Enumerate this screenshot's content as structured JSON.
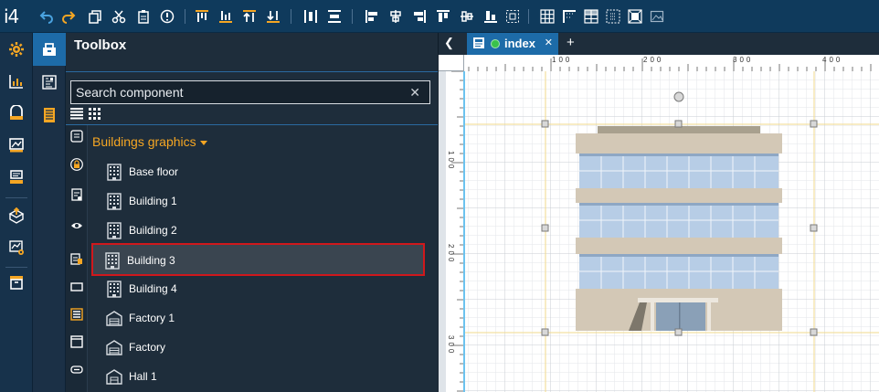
{
  "app": {
    "logo": "i4"
  },
  "toolbar": {
    "icons": [
      "undo-icon",
      "redo-icon",
      "copy-icon",
      "cut-icon",
      "paste-icon",
      "info-icon",
      "align-top-icon",
      "align-bottom-icon",
      "bring-forward-icon",
      "send-backward-icon",
      "distribute-horizontal-icon",
      "distribute-vertical-icon",
      "align-left-icon",
      "align-center-icon",
      "align-right-icon",
      "align-top-edge-icon",
      "align-middle-icon",
      "align-bottom-edge-icon",
      "group-icon",
      "grid-icon",
      "corner-icon",
      "table-icon",
      "select-icon",
      "component-icon",
      "image-icon"
    ]
  },
  "rail": {
    "icons": [
      "settings-icon",
      "dashboard-icon",
      "device-icon",
      "monitor-icon",
      "printer-icon",
      "export-icon",
      "chart-settings-icon",
      "archive-icon"
    ]
  },
  "panel_tabs": {
    "icons": [
      "toolbox-icon",
      "component-tree-icon",
      "page-icon"
    ]
  },
  "toolbox": {
    "title": "Toolbox",
    "search": {
      "placeholder": "Search component",
      "value": ""
    },
    "clear_symbol": "✕",
    "group": "Buildings graphics",
    "categories": [
      "list-icon",
      "lock-icon",
      "doc-icon",
      "eye-icon",
      "clipboard-icon",
      "rectangle-icon",
      "menu-icon",
      "frame-icon",
      "link-icon"
    ],
    "items": [
      {
        "label": "Base floor",
        "icon": "building-icon"
      },
      {
        "label": "Building 1",
        "icon": "building-icon"
      },
      {
        "label": "Building 2",
        "icon": "building-icon"
      },
      {
        "label": "Building 3",
        "icon": "building-icon",
        "selected": true
      },
      {
        "label": "Building 4",
        "icon": "building-icon"
      },
      {
        "label": "Factory 1",
        "icon": "factory-icon"
      },
      {
        "label": "Factory",
        "icon": "factory-icon"
      },
      {
        "label": "Hall 1",
        "icon": "hall-icon"
      }
    ]
  },
  "editor": {
    "nav_left": "❮",
    "tab": {
      "name": "index",
      "close": "✕"
    },
    "add": "+",
    "ruler_top": [
      "100",
      "200",
      "300",
      "400"
    ],
    "ruler_left": [
      "100",
      "200",
      "300"
    ]
  },
  "colors": {
    "accent": "#1d6ba8",
    "group": "#f5a623",
    "selection": "#d0181c",
    "status_dot": "#39c24b",
    "grid": "#e3e6ea",
    "guide": "#f2d98b"
  }
}
